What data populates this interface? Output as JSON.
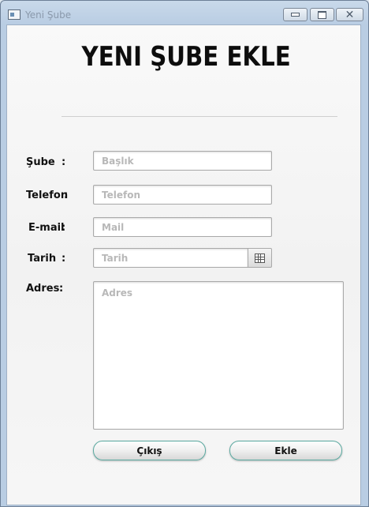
{
  "window": {
    "title": "Yeni Şube"
  },
  "page": {
    "heading": "YENI ŞUBE EKLE"
  },
  "form": {
    "branch": {
      "label": "Şube",
      "colon": ":",
      "placeholder": "Başlık"
    },
    "phone": {
      "label": "Telefon",
      "colon": ":",
      "placeholder": "Telefon"
    },
    "email": {
      "label": "E-mail",
      "colon": ":",
      "placeholder": "Mail"
    },
    "date": {
      "label": "Tarih",
      "colon": ":",
      "placeholder": "Tarih"
    },
    "address": {
      "label": "Adres",
      "colon": ":",
      "placeholder": "Adres"
    }
  },
  "buttons": {
    "exit": "Çıkış",
    "add": "Ekle"
  }
}
